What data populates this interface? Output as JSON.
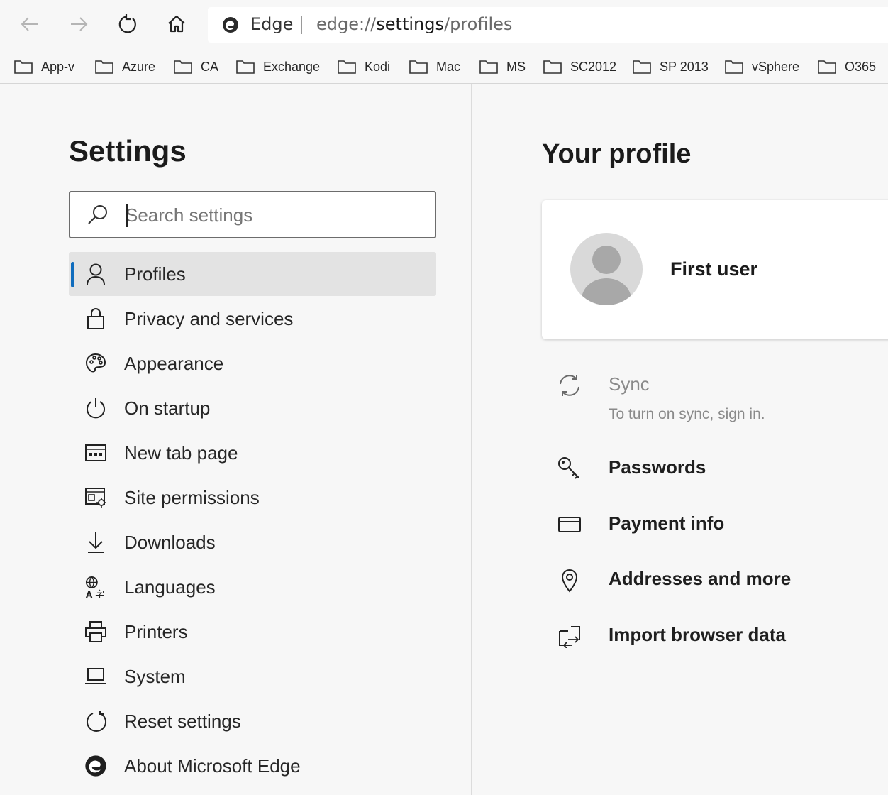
{
  "browser": {
    "address_label": "Edge",
    "url_prefix": "edge://",
    "url_host": "settings",
    "url_path": "/profiles"
  },
  "favorites": [
    {
      "label": "App-v"
    },
    {
      "label": "Azure"
    },
    {
      "label": "CA"
    },
    {
      "label": "Exchange"
    },
    {
      "label": "Kodi"
    },
    {
      "label": "Mac"
    },
    {
      "label": "MS"
    },
    {
      "label": "SC2012"
    },
    {
      "label": "SP 2013"
    },
    {
      "label": "vSphere"
    },
    {
      "label": "O365"
    }
  ],
  "sidebar": {
    "title": "Settings",
    "search_placeholder": "Search settings",
    "items": [
      {
        "label": "Profiles",
        "icon": "person-icon"
      },
      {
        "label": "Privacy and services",
        "icon": "lock-icon"
      },
      {
        "label": "Appearance",
        "icon": "palette-icon"
      },
      {
        "label": "On startup",
        "icon": "power-icon"
      },
      {
        "label": "New tab page",
        "icon": "new-tab-icon"
      },
      {
        "label": "Site permissions",
        "icon": "site-permissions-icon"
      },
      {
        "label": "Downloads",
        "icon": "download-icon"
      },
      {
        "label": "Languages",
        "icon": "languages-icon"
      },
      {
        "label": "Printers",
        "icon": "printer-icon"
      },
      {
        "label": "System",
        "icon": "laptop-icon"
      },
      {
        "label": "Reset settings",
        "icon": "reset-icon"
      },
      {
        "label": "About Microsoft Edge",
        "icon": "edge-logo-icon"
      }
    ]
  },
  "main": {
    "title": "Your profile",
    "profile": {
      "name": "First user"
    },
    "sync": {
      "label": "Sync",
      "subtitle": "To turn on sync, sign in."
    },
    "rows": [
      {
        "label": "Passwords",
        "icon": "key-icon"
      },
      {
        "label": "Payment info",
        "icon": "card-icon"
      },
      {
        "label": "Addresses and more",
        "icon": "location-pin-icon"
      },
      {
        "label": "Import browser data",
        "icon": "import-icon"
      }
    ]
  },
  "colors": {
    "accent": "#0f6cbd",
    "page_bg": "#f7f7f7",
    "active_item_bg": "#e3e3e3"
  }
}
